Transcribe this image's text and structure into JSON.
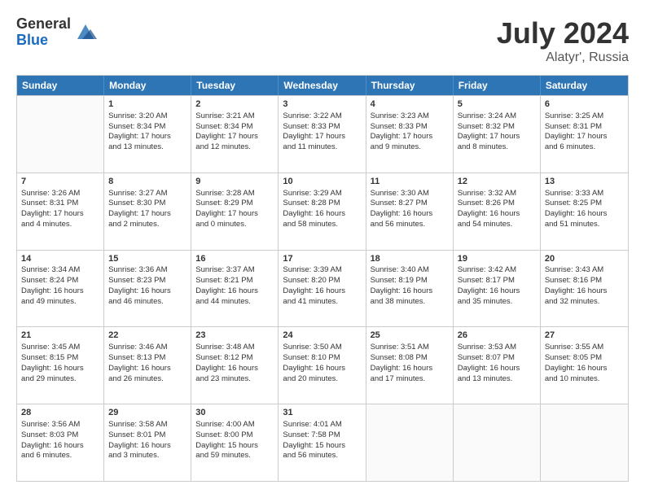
{
  "header": {
    "logo_general": "General",
    "logo_blue": "Blue",
    "month_year": "July 2024",
    "location": "Alatyr', Russia"
  },
  "days_of_week": [
    "Sunday",
    "Monday",
    "Tuesday",
    "Wednesday",
    "Thursday",
    "Friday",
    "Saturday"
  ],
  "weeks": [
    [
      {
        "day": "",
        "data": []
      },
      {
        "day": "1",
        "data": [
          "Sunrise: 3:20 AM",
          "Sunset: 8:34 PM",
          "Daylight: 17 hours",
          "and 13 minutes."
        ]
      },
      {
        "day": "2",
        "data": [
          "Sunrise: 3:21 AM",
          "Sunset: 8:34 PM",
          "Daylight: 17 hours",
          "and 12 minutes."
        ]
      },
      {
        "day": "3",
        "data": [
          "Sunrise: 3:22 AM",
          "Sunset: 8:33 PM",
          "Daylight: 17 hours",
          "and 11 minutes."
        ]
      },
      {
        "day": "4",
        "data": [
          "Sunrise: 3:23 AM",
          "Sunset: 8:33 PM",
          "Daylight: 17 hours",
          "and 9 minutes."
        ]
      },
      {
        "day": "5",
        "data": [
          "Sunrise: 3:24 AM",
          "Sunset: 8:32 PM",
          "Daylight: 17 hours",
          "and 8 minutes."
        ]
      },
      {
        "day": "6",
        "data": [
          "Sunrise: 3:25 AM",
          "Sunset: 8:31 PM",
          "Daylight: 17 hours",
          "and 6 minutes."
        ]
      }
    ],
    [
      {
        "day": "7",
        "data": [
          "Sunrise: 3:26 AM",
          "Sunset: 8:31 PM",
          "Daylight: 17 hours",
          "and 4 minutes."
        ]
      },
      {
        "day": "8",
        "data": [
          "Sunrise: 3:27 AM",
          "Sunset: 8:30 PM",
          "Daylight: 17 hours",
          "and 2 minutes."
        ]
      },
      {
        "day": "9",
        "data": [
          "Sunrise: 3:28 AM",
          "Sunset: 8:29 PM",
          "Daylight: 17 hours",
          "and 0 minutes."
        ]
      },
      {
        "day": "10",
        "data": [
          "Sunrise: 3:29 AM",
          "Sunset: 8:28 PM",
          "Daylight: 16 hours",
          "and 58 minutes."
        ]
      },
      {
        "day": "11",
        "data": [
          "Sunrise: 3:30 AM",
          "Sunset: 8:27 PM",
          "Daylight: 16 hours",
          "and 56 minutes."
        ]
      },
      {
        "day": "12",
        "data": [
          "Sunrise: 3:32 AM",
          "Sunset: 8:26 PM",
          "Daylight: 16 hours",
          "and 54 minutes."
        ]
      },
      {
        "day": "13",
        "data": [
          "Sunrise: 3:33 AM",
          "Sunset: 8:25 PM",
          "Daylight: 16 hours",
          "and 51 minutes."
        ]
      }
    ],
    [
      {
        "day": "14",
        "data": [
          "Sunrise: 3:34 AM",
          "Sunset: 8:24 PM",
          "Daylight: 16 hours",
          "and 49 minutes."
        ]
      },
      {
        "day": "15",
        "data": [
          "Sunrise: 3:36 AM",
          "Sunset: 8:23 PM",
          "Daylight: 16 hours",
          "and 46 minutes."
        ]
      },
      {
        "day": "16",
        "data": [
          "Sunrise: 3:37 AM",
          "Sunset: 8:21 PM",
          "Daylight: 16 hours",
          "and 44 minutes."
        ]
      },
      {
        "day": "17",
        "data": [
          "Sunrise: 3:39 AM",
          "Sunset: 8:20 PM",
          "Daylight: 16 hours",
          "and 41 minutes."
        ]
      },
      {
        "day": "18",
        "data": [
          "Sunrise: 3:40 AM",
          "Sunset: 8:19 PM",
          "Daylight: 16 hours",
          "and 38 minutes."
        ]
      },
      {
        "day": "19",
        "data": [
          "Sunrise: 3:42 AM",
          "Sunset: 8:17 PM",
          "Daylight: 16 hours",
          "and 35 minutes."
        ]
      },
      {
        "day": "20",
        "data": [
          "Sunrise: 3:43 AM",
          "Sunset: 8:16 PM",
          "Daylight: 16 hours",
          "and 32 minutes."
        ]
      }
    ],
    [
      {
        "day": "21",
        "data": [
          "Sunrise: 3:45 AM",
          "Sunset: 8:15 PM",
          "Daylight: 16 hours",
          "and 29 minutes."
        ]
      },
      {
        "day": "22",
        "data": [
          "Sunrise: 3:46 AM",
          "Sunset: 8:13 PM",
          "Daylight: 16 hours",
          "and 26 minutes."
        ]
      },
      {
        "day": "23",
        "data": [
          "Sunrise: 3:48 AM",
          "Sunset: 8:12 PM",
          "Daylight: 16 hours",
          "and 23 minutes."
        ]
      },
      {
        "day": "24",
        "data": [
          "Sunrise: 3:50 AM",
          "Sunset: 8:10 PM",
          "Daylight: 16 hours",
          "and 20 minutes."
        ]
      },
      {
        "day": "25",
        "data": [
          "Sunrise: 3:51 AM",
          "Sunset: 8:08 PM",
          "Daylight: 16 hours",
          "and 17 minutes."
        ]
      },
      {
        "day": "26",
        "data": [
          "Sunrise: 3:53 AM",
          "Sunset: 8:07 PM",
          "Daylight: 16 hours",
          "and 13 minutes."
        ]
      },
      {
        "day": "27",
        "data": [
          "Sunrise: 3:55 AM",
          "Sunset: 8:05 PM",
          "Daylight: 16 hours",
          "and 10 minutes."
        ]
      }
    ],
    [
      {
        "day": "28",
        "data": [
          "Sunrise: 3:56 AM",
          "Sunset: 8:03 PM",
          "Daylight: 16 hours",
          "and 6 minutes."
        ]
      },
      {
        "day": "29",
        "data": [
          "Sunrise: 3:58 AM",
          "Sunset: 8:01 PM",
          "Daylight: 16 hours",
          "and 3 minutes."
        ]
      },
      {
        "day": "30",
        "data": [
          "Sunrise: 4:00 AM",
          "Sunset: 8:00 PM",
          "Daylight: 15 hours",
          "and 59 minutes."
        ]
      },
      {
        "day": "31",
        "data": [
          "Sunrise: 4:01 AM",
          "Sunset: 7:58 PM",
          "Daylight: 15 hours",
          "and 56 minutes."
        ]
      },
      {
        "day": "",
        "data": []
      },
      {
        "day": "",
        "data": []
      },
      {
        "day": "",
        "data": []
      }
    ]
  ]
}
